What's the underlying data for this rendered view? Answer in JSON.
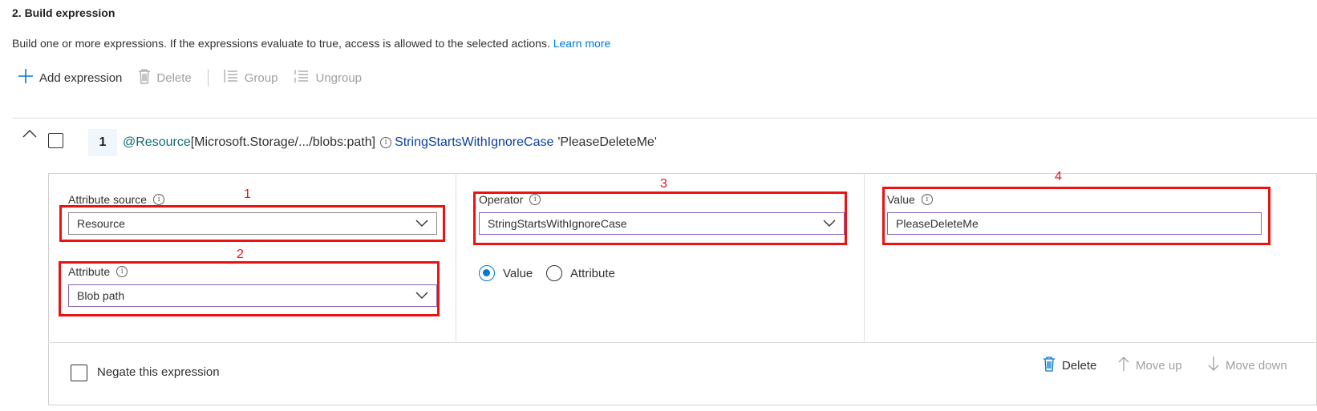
{
  "section": {
    "title": "2. Build expression",
    "description": "Build one or more expressions. If the expressions evaluate to true, access is allowed to the selected actions.",
    "learn_more": "Learn more"
  },
  "toolbar": {
    "add_label": "Add expression",
    "delete_label": "Delete",
    "group_label": "Group",
    "ungroup_label": "Ungroup"
  },
  "expression_row": {
    "number": "1",
    "prefix": "@Resource",
    "path": "[Microsoft.Storage/.../blobs:path]",
    "operator": "StringStartsWithIgnoreCase",
    "value": "'PleaseDeleteMe'"
  },
  "editor": {
    "attribute_source": {
      "label": "Attribute source",
      "value": "Resource"
    },
    "attribute": {
      "label": "Attribute",
      "value": "Blob path"
    },
    "operator": {
      "label": "Operator",
      "value": "StringStartsWithIgnoreCase"
    },
    "compare_type": {
      "option_value": "Value",
      "option_attribute": "Attribute",
      "selected": "Value"
    },
    "value_field": {
      "label": "Value",
      "value": "PleaseDeleteMe"
    },
    "negate_label": "Negate this expression"
  },
  "footer": {
    "delete_label": "Delete",
    "move_up_label": "Move up",
    "move_down_label": "Move down"
  },
  "annotations": {
    "n1": "1",
    "n2": "2",
    "n3": "3",
    "n4": "4"
  },
  "colors": {
    "accent": "#0078d4",
    "annotation_red": "#ee1111",
    "focus_purple": "#8764b8"
  }
}
